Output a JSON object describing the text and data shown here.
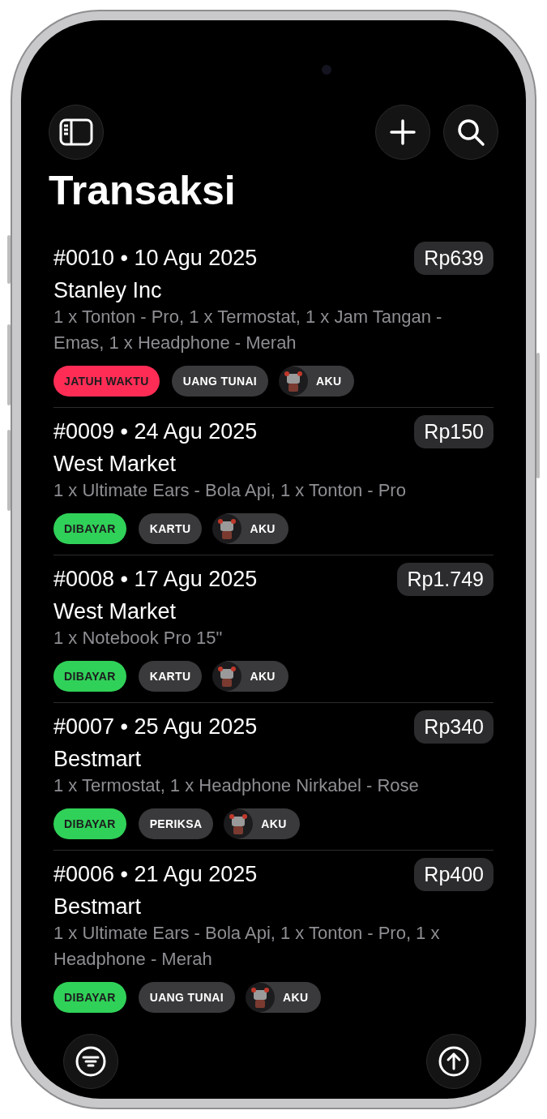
{
  "title": "Transaksi",
  "separator": "•",
  "transactions": [
    {
      "number": "#0010",
      "date": "10 Agu 2025",
      "amount": "Rp639",
      "customer": "Stanley Inc",
      "items": "1 x Tonton - Pro, 1 x Termostat, 1 x Jam Tangan - Emas, 1 x Headphone - Merah",
      "tags": [
        {
          "kind": "status",
          "label": "JATUH WAKTU",
          "color": "#ff2d55"
        },
        {
          "kind": "method",
          "label": "UANG TUNAI"
        },
        {
          "kind": "user",
          "label": "AKU"
        }
      ]
    },
    {
      "number": "#0009",
      "date": "24 Agu 2025",
      "amount": "Rp150",
      "customer": "West Market",
      "items": "1 x Ultimate Ears - Bola Api, 1 x Tonton - Pro",
      "tags": [
        {
          "kind": "status",
          "label": "DIBAYAR",
          "color": "#30d158"
        },
        {
          "kind": "method",
          "label": "KARTU"
        },
        {
          "kind": "user",
          "label": "AKU"
        }
      ]
    },
    {
      "number": "#0008",
      "date": "17 Agu 2025",
      "amount": "Rp1.749",
      "customer": "West Market",
      "items": "1 x Notebook Pro 15\"",
      "tags": [
        {
          "kind": "status",
          "label": "DIBAYAR",
          "color": "#30d158"
        },
        {
          "kind": "method",
          "label": "KARTU"
        },
        {
          "kind": "user",
          "label": "AKU"
        }
      ]
    },
    {
      "number": "#0007",
      "date": "25 Agu 2025",
      "amount": "Rp340",
      "customer": "Bestmart",
      "items": "1 x Termostat, 1 x Headphone Nirkabel - Rose",
      "tags": [
        {
          "kind": "status",
          "label": "DIBAYAR",
          "color": "#30d158"
        },
        {
          "kind": "method",
          "label": "PERIKSA"
        },
        {
          "kind": "user",
          "label": "AKU"
        }
      ]
    },
    {
      "number": "#0006",
      "date": "21 Agu 2025",
      "amount": "Rp400",
      "customer": "Bestmart",
      "items": "1 x Ultimate Ears - Bola Api, 1 x Tonton - Pro, 1 x Headphone - Merah",
      "tags": [
        {
          "kind": "status",
          "label": "DIBAYAR",
          "color": "#30d158"
        },
        {
          "kind": "method",
          "label": "UANG TUNAI"
        },
        {
          "kind": "user",
          "label": "AKU"
        }
      ]
    }
  ]
}
